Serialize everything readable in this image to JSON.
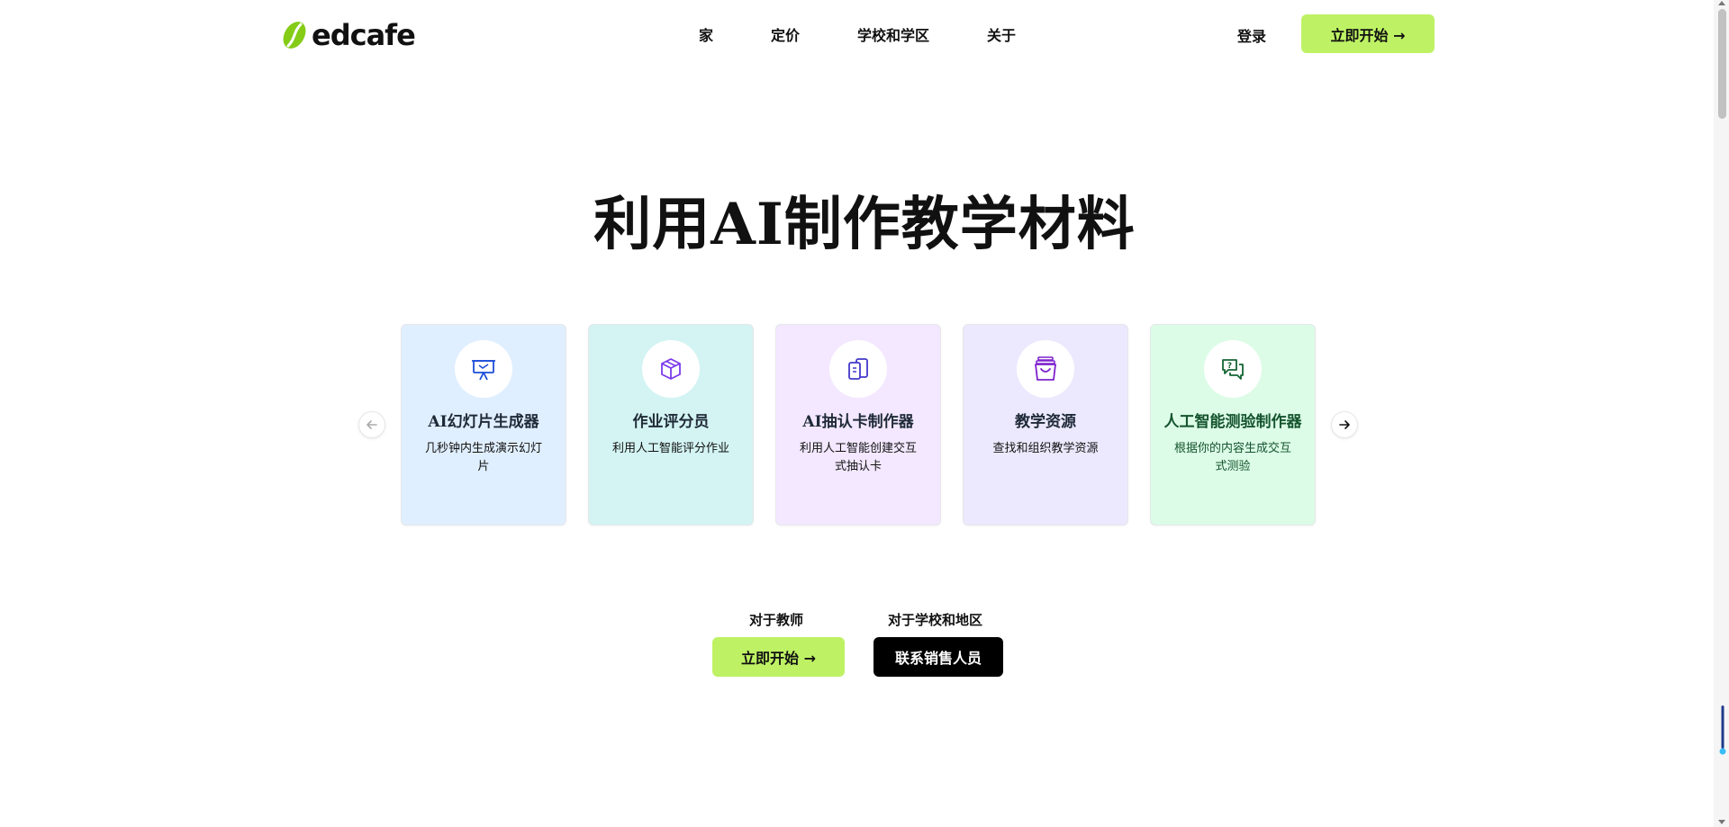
{
  "header": {
    "logo_text": "edcafe",
    "nav": [
      "家",
      "定价",
      "学校和学区",
      "关于"
    ],
    "login_label": "登录",
    "cta_label": "立即开始 →"
  },
  "hero": {
    "title": "利用AI制作教学材料"
  },
  "features": [
    {
      "title": "AI幻灯片生成器",
      "desc": "几秒钟内生成演示幻灯片",
      "icon": "presentation-board-icon",
      "accent": "#1d4ed8"
    },
    {
      "title": "作业评分员",
      "desc": "利用人工智能评分作业",
      "icon": "cube-icon",
      "accent": "#7c3aed"
    },
    {
      "title": "AI抽认卡制作器",
      "desc": "利用人工智能创建交互式抽认卡",
      "icon": "flashcards-icon",
      "accent": "#4338ca"
    },
    {
      "title": "教学资源",
      "desc": "查找和组织教学资源",
      "icon": "archive-box-icon",
      "accent": "#7e22ce"
    },
    {
      "title": "人工智能测验制作器",
      "desc": "根据你的内容生成交互式测验",
      "icon": "question-chat-icon",
      "accent": "#166534"
    }
  ],
  "ctas": {
    "teachers_label": "对于教师",
    "teachers_button": "立即开始 →",
    "schools_label": "对于学校和地区",
    "schools_button": "联系销售人员"
  },
  "colors": {
    "brand_lime": "#bef264",
    "logo_green": "#84cc16",
    "dark_button": "#000000"
  }
}
